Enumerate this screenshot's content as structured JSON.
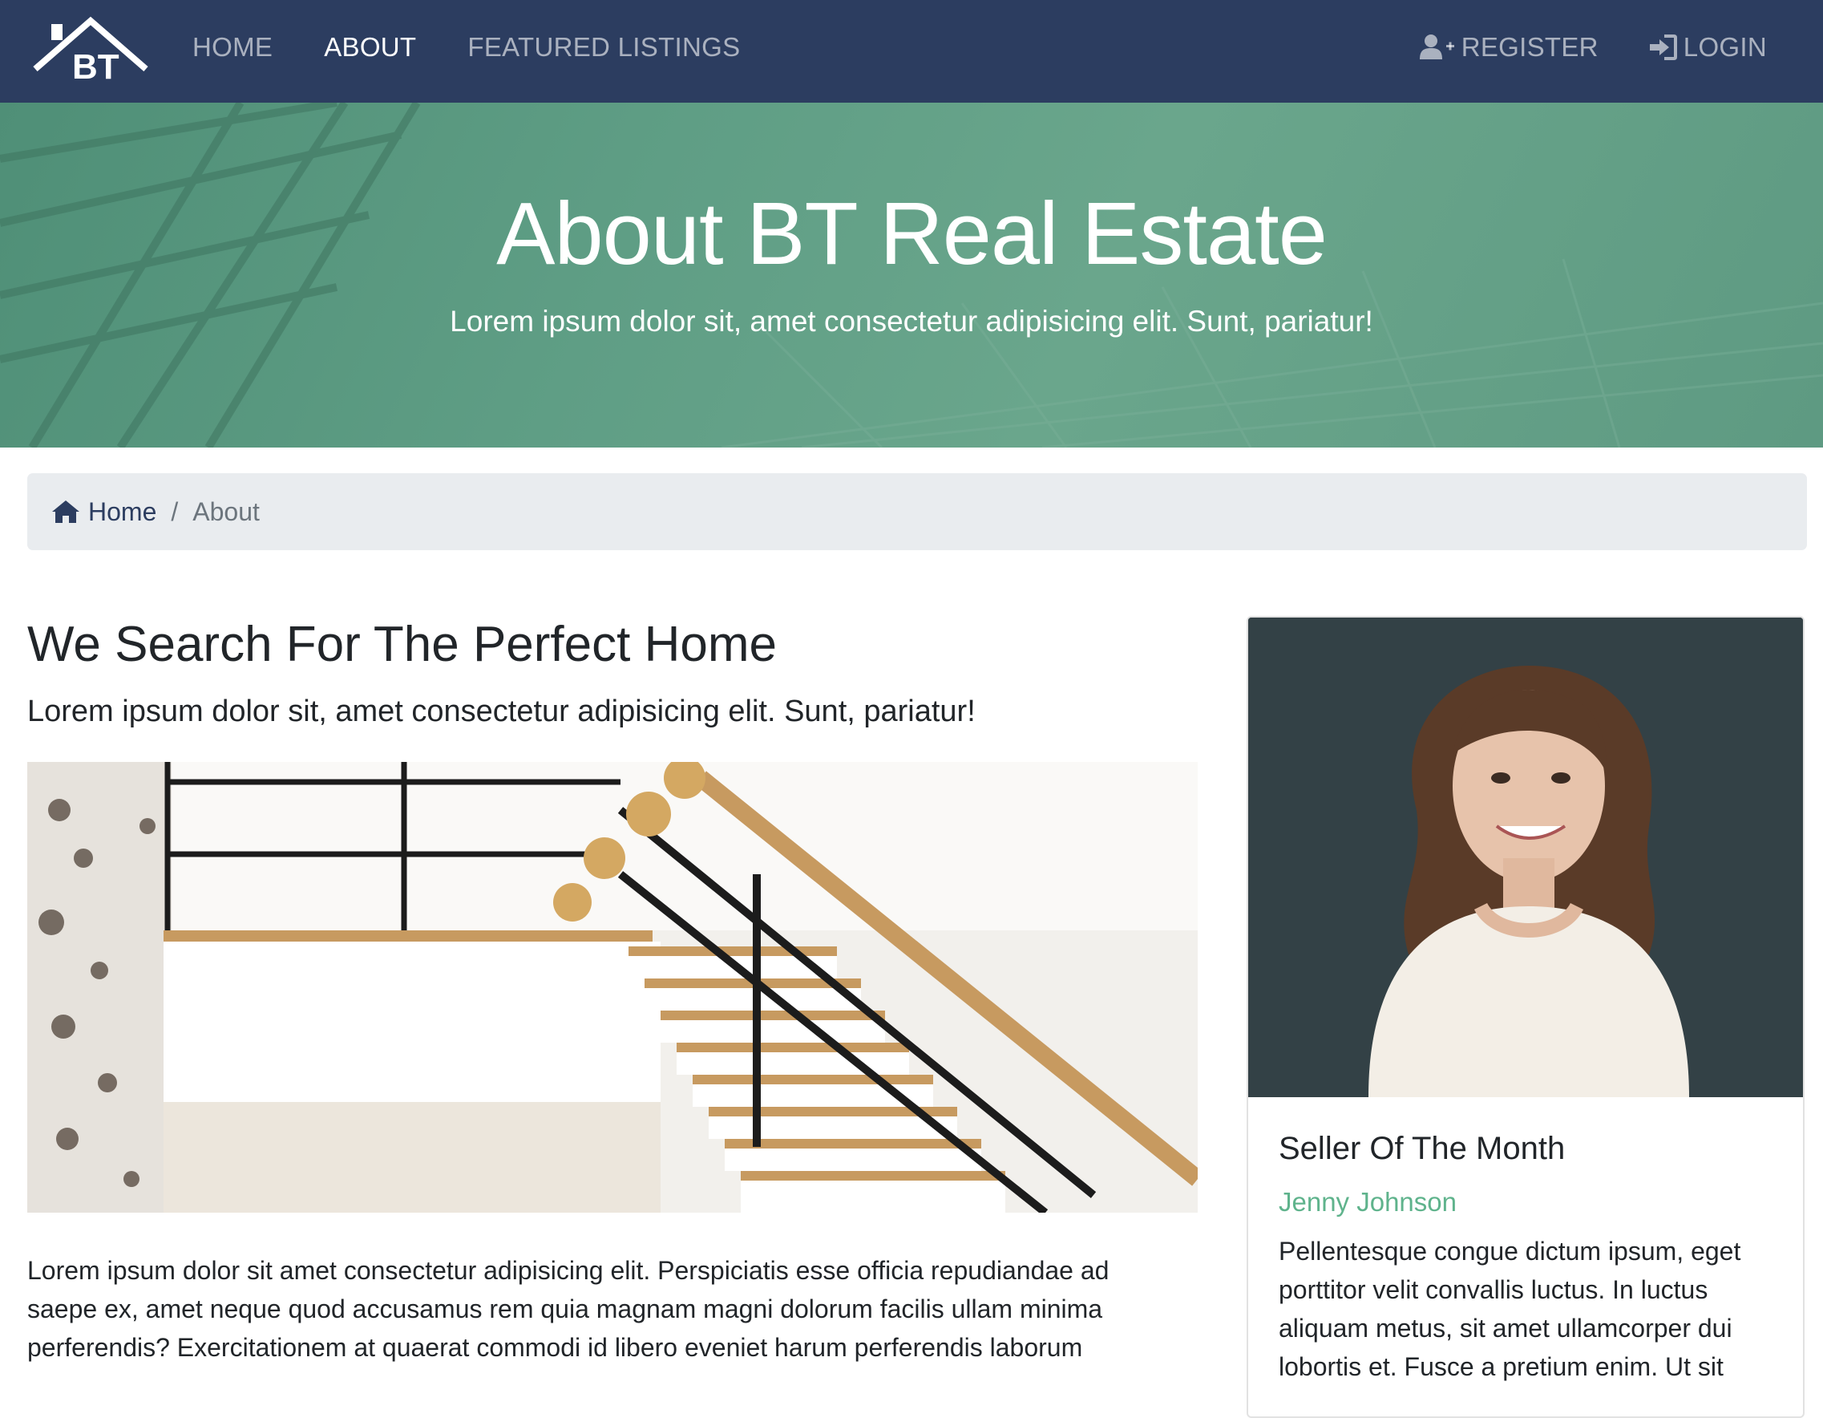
{
  "nav": {
    "brand_text": "BT",
    "links": [
      "HOME",
      "ABOUT",
      "FEATURED LISTINGS"
    ],
    "active_link": "ABOUT",
    "register_label": "REGISTER",
    "login_label": "LOGIN"
  },
  "hero": {
    "title": "About BT Real Estate",
    "subtitle": "Lorem ipsum dolor sit, amet consectetur adipisicing elit. Sunt, pariatur!"
  },
  "breadcrumb": {
    "home": "Home",
    "separator": "/",
    "current": "About"
  },
  "main": {
    "heading": "We Search For The Perfect Home",
    "lead": "Lorem ipsum dolor sit, amet consectetur adipisicing elit. Sunt, pariatur!",
    "body": "Lorem ipsum dolor sit amet consectetur adipisicing elit. Perspiciatis esse officia repudiandae ad saepe ex, amet neque quod accusamus rem quia magnam magni dolorum facilis ullam minima perferendis? Exercitationem at quaerat commodi id libero eveniet harum perferendis laborum"
  },
  "seller": {
    "title": "Seller Of The Month",
    "name": "Jenny Johnson",
    "text": "Pellentesque congue dictum ipsum, eget porttitor velit convallis luctus. In luctus aliquam metus, sit amet ullamcorper dui lobortis et. Fusce a pretium enim. Ut sit"
  },
  "colors": {
    "navbar": "#2c3d60",
    "hero_green": "#5f9e85",
    "accent_green": "#5fb38c",
    "breadcrumb_bg": "#e9ecef"
  },
  "icons": {
    "brand": "house-roof-logo",
    "register": "user-plus-icon",
    "login": "sign-in-icon",
    "home": "home-icon"
  }
}
